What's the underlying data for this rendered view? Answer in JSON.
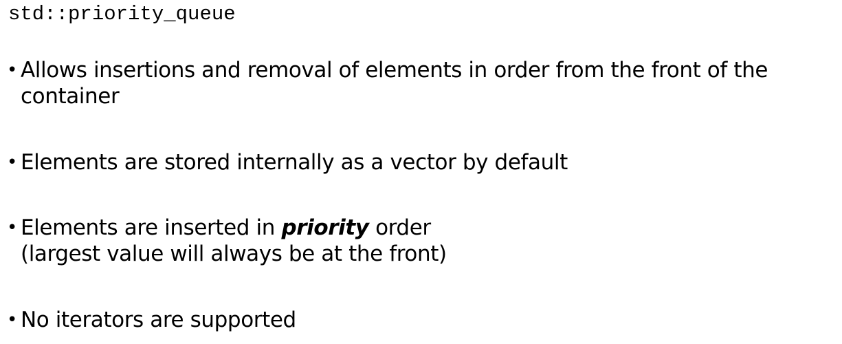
{
  "title": "std::priority_queue",
  "bullets": {
    "item1": {
      "text": "Allows insertions and removal of elements in order from the front of the container"
    },
    "item2": {
      "text": "Elements are stored internally as a vector by default"
    },
    "item3": {
      "before": "Elements are inserted in ",
      "emphasis": "priority",
      "after": " order",
      "line2": "(largest value will always be at the front)"
    },
    "item4": {
      "text": "No iterators are supported"
    }
  },
  "bullet_glyph": "•"
}
